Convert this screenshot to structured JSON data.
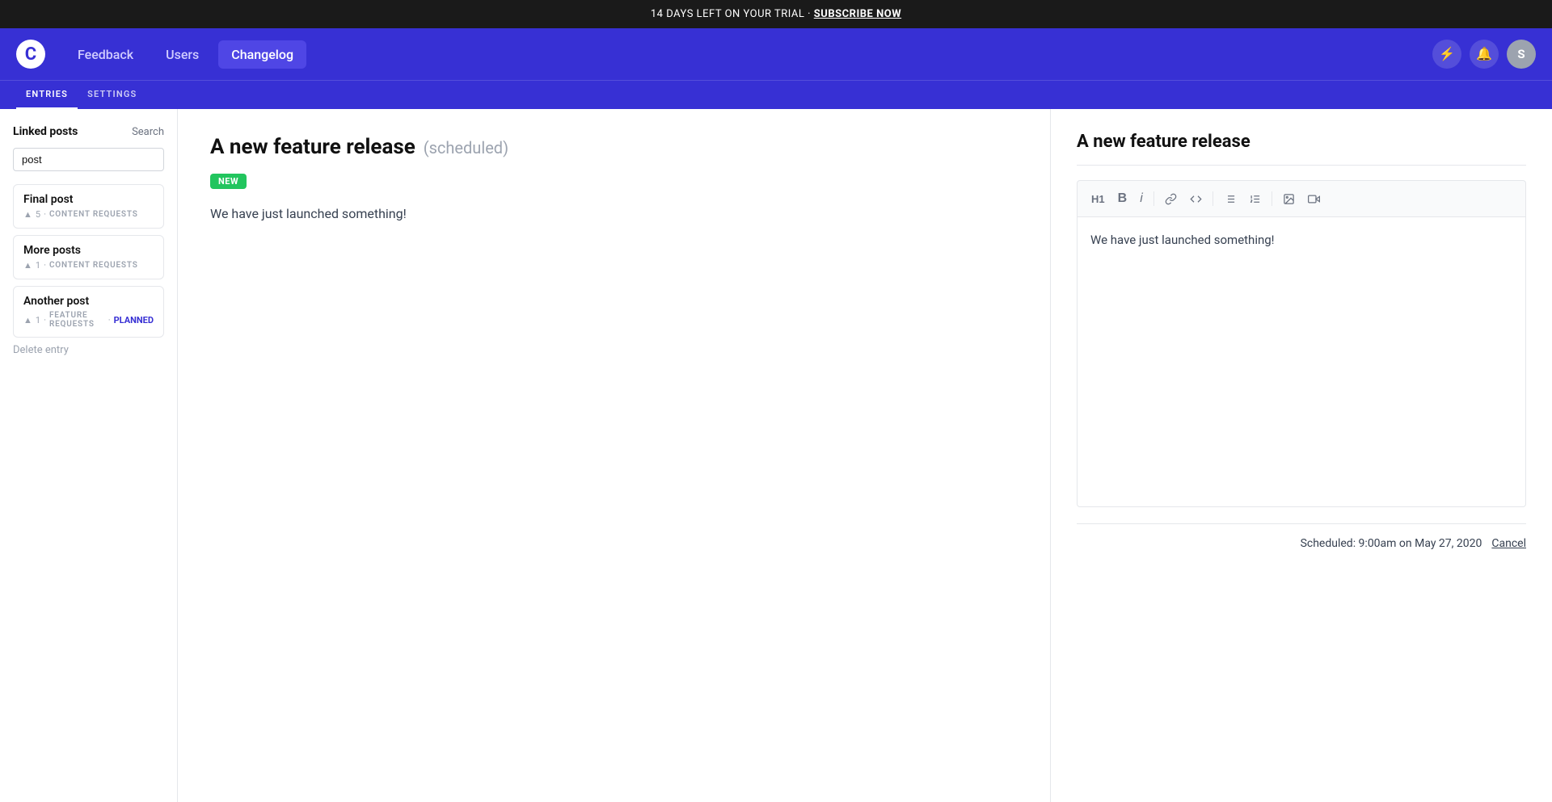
{
  "trial_banner": {
    "text": "14 DAYS LEFT ON YOUR TRIAL · ",
    "cta": "SUBSCRIBE NOW"
  },
  "nav": {
    "logo": "C",
    "links": [
      {
        "label": "Feedback",
        "active": false
      },
      {
        "label": "Users",
        "active": false
      },
      {
        "label": "Changelog",
        "active": true
      }
    ],
    "icons": {
      "lightning": "⚡",
      "bell": "🔔",
      "avatar_initial": "S"
    }
  },
  "sub_nav": {
    "links": [
      {
        "label": "ENTRIES",
        "active": true
      },
      {
        "label": "SETTINGS",
        "active": false
      }
    ]
  },
  "sidebar": {
    "title": "Linked posts",
    "search_label": "Search",
    "search_value": "post",
    "posts": [
      {
        "title": "Final post",
        "votes": "5",
        "category": "CONTENT REQUESTS",
        "badge": null
      },
      {
        "title": "More posts",
        "votes": "1",
        "category": "CONTENT REQUESTS",
        "badge": null
      },
      {
        "title": "Another post",
        "votes": "1",
        "category": "FEATURE REQUESTS",
        "badge": "PLANNED"
      }
    ],
    "delete_entry": "Delete entry"
  },
  "center": {
    "title": "A new feature release",
    "status": "(scheduled)",
    "badge": "NEW",
    "body": "We have just launched something!"
  },
  "editor": {
    "title": "A new feature release",
    "body": "We have just launched something!",
    "toolbar": {
      "h1": "H1",
      "bold": "B",
      "italic": "i",
      "link": "🔗",
      "code": "<>",
      "ul": "≡",
      "ol": "≣",
      "image": "🖼",
      "video": "▶"
    },
    "footer": {
      "scheduled_text": "Scheduled: 9:00am on May 27, 2020",
      "cancel": "Cancel"
    }
  }
}
